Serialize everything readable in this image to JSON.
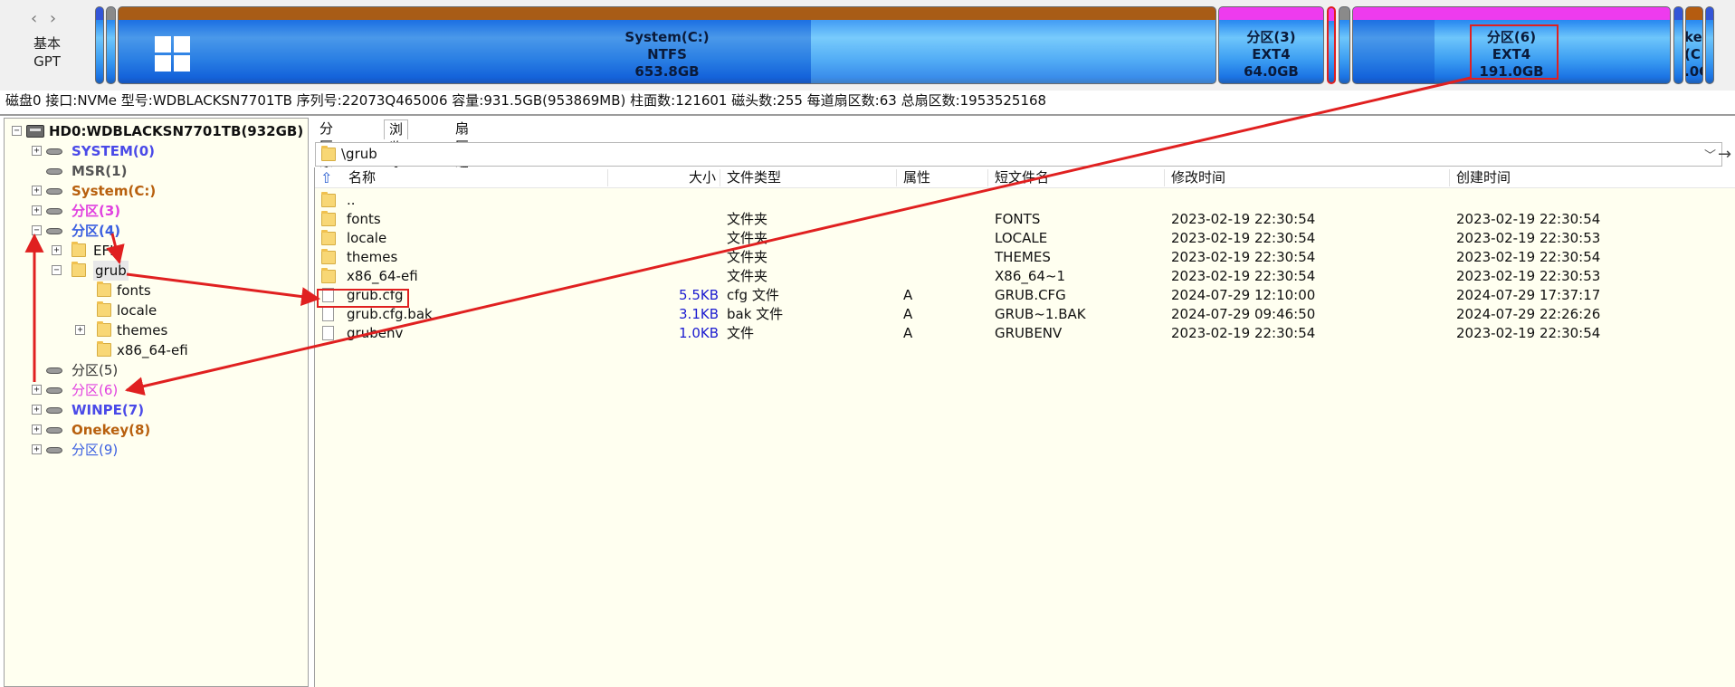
{
  "disk_bar": {
    "nav_arrows": "‹ ›",
    "disk_type_line1": "基本",
    "disk_type_line2": "GPT",
    "partitions": [
      {
        "key": "system_c",
        "name": "System(C:)",
        "fs": "NTFS",
        "size": "653.8GB",
        "color": "#a85c16"
      },
      {
        "key": "part3",
        "name": "分区(3)",
        "fs": "EXT4",
        "size": "64.0GB",
        "color": "#ee3bee"
      },
      {
        "key": "part6",
        "name": "分区(6)",
        "fs": "EXT4",
        "size": "191.0GB",
        "color": "#ee3bee"
      },
      {
        "key": "onekey_partial",
        "name": "ke",
        "fs": "(C",
        "size": ".0C",
        "color": "#b55c10"
      }
    ]
  },
  "disk_info": "磁盘0 接口:NVMe  型号:WDBLACKSN7701TB  序列号:22073Q465006  容量:931.5GB(953869MB)  柱面数:121601  磁头数:255  每道扇区数:63  总扇区数:1953525168",
  "tree": {
    "root": "HD0:WDBLACKSN7701TB(932GB)",
    "items": [
      {
        "label": "SYSTEM(0)",
        "color": "#4a4ae8"
      },
      {
        "label": "MSR(1)",
        "color": "#555555"
      },
      {
        "label": "System(C:)",
        "color": "#b8600e"
      },
      {
        "label": "分区(3)",
        "color": "#e040e0"
      },
      {
        "label": "分区(4)",
        "color": "#3a5ee0"
      },
      {
        "label": "EFI",
        "color": "#111111"
      },
      {
        "label": "grub",
        "color": "#111111"
      },
      {
        "label": "fonts",
        "color": "#111111"
      },
      {
        "label": "locale",
        "color": "#111111"
      },
      {
        "label": "themes",
        "color": "#111111"
      },
      {
        "label": "x86_64-efi",
        "color": "#111111"
      },
      {
        "label": "分区(5)",
        "color": "#333333"
      },
      {
        "label": "分区(6)",
        "color": "#e040e0"
      },
      {
        "label": "WINPE(7)",
        "color": "#4a4ae8"
      },
      {
        "label": "Onekey(8)",
        "color": "#b8600e"
      },
      {
        "label": "分区(9)",
        "color": "#3a5ee0"
      }
    ]
  },
  "tabs": [
    "分区参数",
    "浏览文件",
    "扇区编辑"
  ],
  "path": "\\grub",
  "columns": [
    "名称",
    "大小",
    "文件类型",
    "属性",
    "短文件名",
    "修改时间",
    "创建时间"
  ],
  "rows": [
    {
      "name": "..",
      "size": "",
      "type": "",
      "attr": "",
      "short": "",
      "modified": "",
      "created": "",
      "kind": "folder"
    },
    {
      "name": "fonts",
      "size": "",
      "type": "文件夹",
      "attr": "",
      "short": "FONTS",
      "modified": "2023-02-19 22:30:54",
      "created": "2023-02-19 22:30:54",
      "kind": "folder"
    },
    {
      "name": "locale",
      "size": "",
      "type": "文件夹",
      "attr": "",
      "short": "LOCALE",
      "modified": "2023-02-19 22:30:54",
      "created": "2023-02-19 22:30:53",
      "kind": "folder"
    },
    {
      "name": "themes",
      "size": "",
      "type": "文件夹",
      "attr": "",
      "short": "THEMES",
      "modified": "2023-02-19 22:30:54",
      "created": "2023-02-19 22:30:54",
      "kind": "folder"
    },
    {
      "name": "x86_64-efi",
      "size": "",
      "type": "文件夹",
      "attr": "",
      "short": "X86_64~1",
      "modified": "2023-02-19 22:30:54",
      "created": "2023-02-19 22:30:53",
      "kind": "folder"
    },
    {
      "name": "grub.cfg",
      "size": "5.5KB",
      "type": "cfg 文件",
      "attr": "A",
      "short": "GRUB.CFG",
      "modified": "2024-07-29 12:10:00",
      "created": "2024-07-29 17:37:17",
      "kind": "file"
    },
    {
      "name": "grub.cfg.bak",
      "size": "3.1KB",
      "type": "bak 文件",
      "attr": "A",
      "short": "GRUB~1.BAK",
      "modified": "2024-07-29 09:46:50",
      "created": "2024-07-29 22:26:26",
      "kind": "file"
    },
    {
      "name": "grubenv",
      "size": "1.0KB",
      "type": "文件",
      "attr": "A",
      "short": "GRUBENV",
      "modified": "2023-02-19 22:30:54",
      "created": "2023-02-19 22:30:54",
      "kind": "file"
    }
  ],
  "annotation_color": "#e02020"
}
